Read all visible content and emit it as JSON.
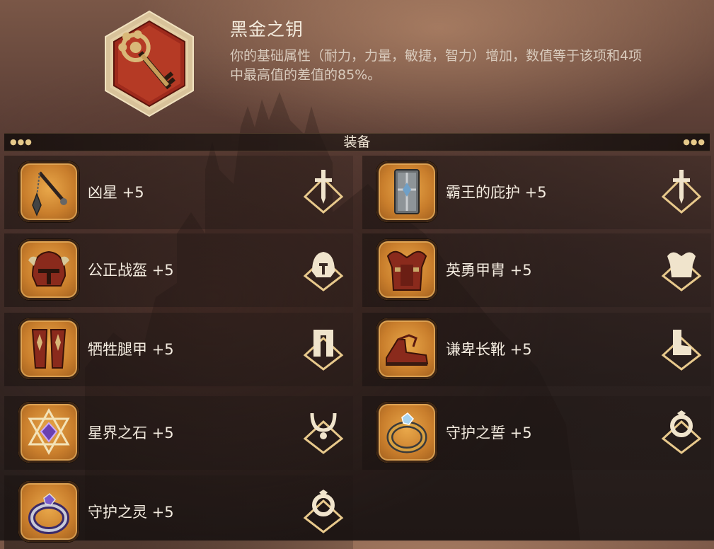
{
  "header": {
    "title": "黑金之钥",
    "description": "你的基础属性（耐力，力量，敏捷，智力）增加，数值等于该项和4项中最高值的差值的85%。",
    "icon": "black-gold-key-icon"
  },
  "section": {
    "title": "装备"
  },
  "equipment": [
    {
      "label": "凶星 +5",
      "icon": "flail-icon",
      "slot": "weapon-slot-icon"
    },
    {
      "label": "霸王的庇护 +5",
      "icon": "shield-icon",
      "slot": "weapon-slot-icon"
    },
    {
      "label": "公正战盔 +5",
      "icon": "helmet-icon",
      "slot": "helmet-slot-icon"
    },
    {
      "label": "英勇甲胄 +5",
      "icon": "chest-armor-icon",
      "slot": "armor-slot-icon"
    },
    {
      "label": "牺牲腿甲 +5",
      "icon": "leg-armor-icon",
      "slot": "legs-slot-icon"
    },
    {
      "label": "谦卑长靴 +5",
      "icon": "boots-icon",
      "slot": "boots-slot-icon"
    },
    {
      "label": "星界之石 +5",
      "icon": "astral-stone-icon",
      "slot": "amulet-slot-icon"
    },
    {
      "label": "守护之誓 +5",
      "icon": "ring-icon",
      "slot": "ring-slot-icon"
    },
    {
      "label": "守护之灵 +5",
      "icon": "spirit-ring-icon",
      "slot": "ring-slot-icon"
    }
  ],
  "colors": {
    "accent_gold": "#e8c98c",
    "item_orange": "#d48a34",
    "badge_red": "#b43a26"
  }
}
